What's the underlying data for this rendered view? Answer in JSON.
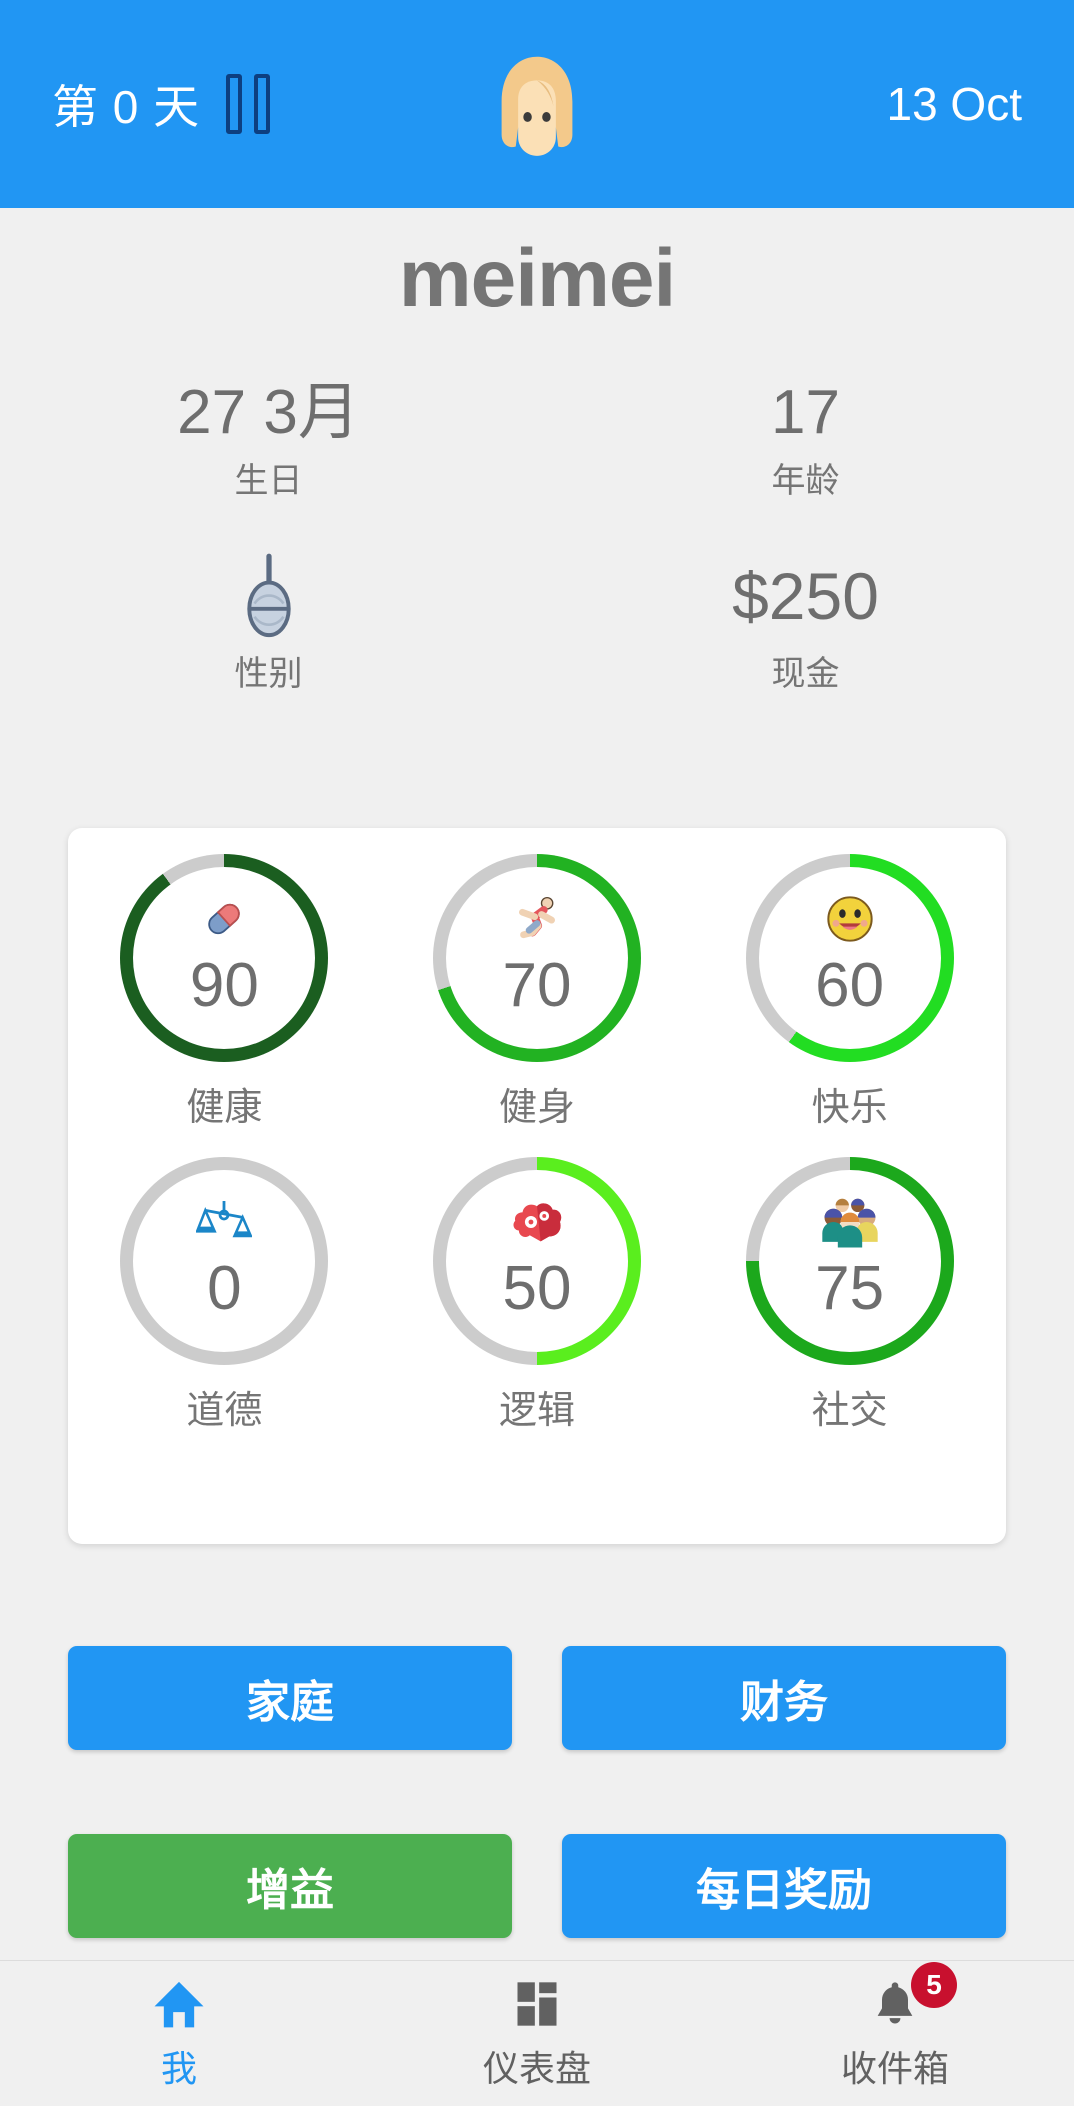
{
  "header": {
    "day_label": "第 0 天",
    "pause_icon": "pause-icon",
    "avatar_icon": "female-avatar",
    "date": "13 Oct",
    "background_color": "#2196f3"
  },
  "profile": {
    "name": "meimei",
    "stats": [
      {
        "value": "27 3月",
        "label": "生日",
        "icon": null
      },
      {
        "value": "17",
        "label": "年龄",
        "icon": null
      },
      {
        "value": "",
        "label": "性别",
        "icon": "female-gender-icon"
      },
      {
        "value": "$250",
        "label": "现金",
        "icon": null
      }
    ]
  },
  "attributes": {
    "card_background": "#ffffff",
    "track_color": "#cccccc",
    "rings": [
      {
        "key": "health",
        "label": "健康",
        "value": 90,
        "max": 100,
        "color": "#1b5e20",
        "icon": "pill-icon"
      },
      {
        "key": "fitness",
        "label": "健身",
        "value": 70,
        "max": 100,
        "color": "#22b222",
        "icon": "runner-icon"
      },
      {
        "key": "happy",
        "label": "快乐",
        "value": 60,
        "max": 100,
        "color": "#22dd22",
        "icon": "smiley-icon"
      },
      {
        "key": "morality",
        "label": "道德",
        "value": 0,
        "max": 100,
        "color": "#cccccc",
        "icon": "scales-icon"
      },
      {
        "key": "logic",
        "label": "逻辑",
        "value": 50,
        "max": 100,
        "color": "#5aee1e",
        "icon": "brain-gears-icon"
      },
      {
        "key": "social",
        "label": "社交",
        "value": 75,
        "max": 100,
        "color": "#1ca81c",
        "icon": "people-group-icon"
      }
    ]
  },
  "actions": [
    {
      "label": "家庭",
      "color": "#2196f3",
      "style": "blue"
    },
    {
      "label": "财务",
      "color": "#2196f3",
      "style": "blue"
    },
    {
      "label": "增益",
      "color": "#4caf50",
      "style": "green"
    },
    {
      "label": "每日奖励",
      "color": "#2196f3",
      "style": "blue"
    }
  ],
  "bottom_nav": {
    "items": [
      {
        "label": "我",
        "icon": "home-icon",
        "active": true,
        "badge": null
      },
      {
        "label": "仪表盘",
        "icon": "dashboard-icon",
        "active": false,
        "badge": null
      },
      {
        "label": "收件箱",
        "icon": "bell-icon",
        "active": false,
        "badge": "5"
      }
    ],
    "active_color": "#2196f3",
    "badge_color": "#c8102e"
  }
}
